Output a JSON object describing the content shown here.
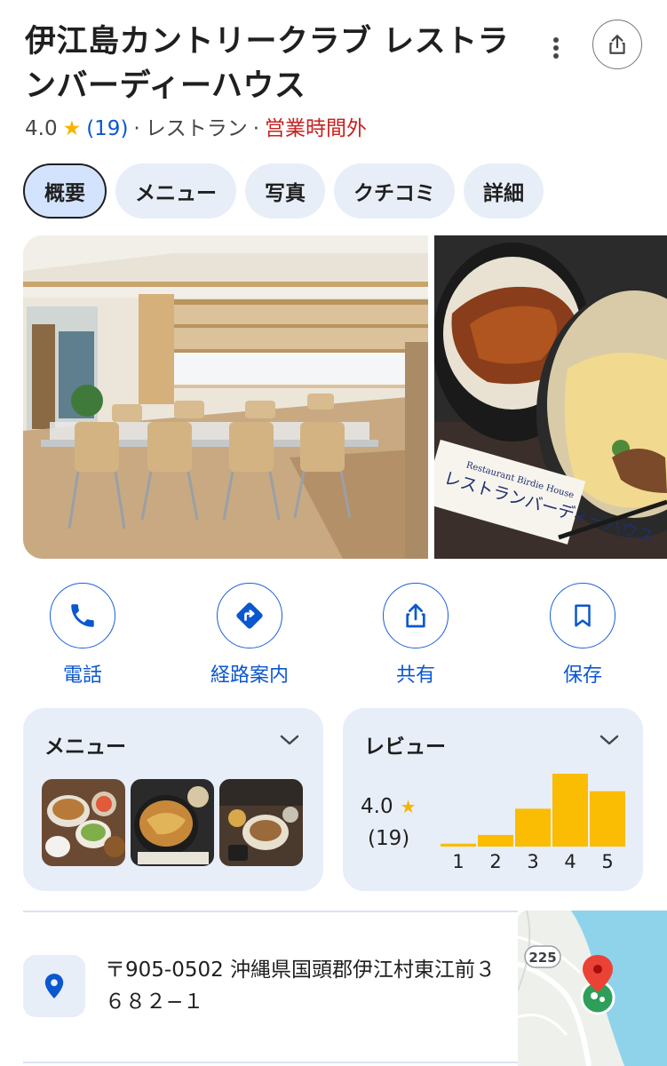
{
  "place": {
    "title": "伊江島カントリークラブ レストランバーディーハウス",
    "rating": "4.0",
    "star": "★",
    "review_count": "(19)",
    "separator": "·",
    "category": "レストラン",
    "status": "営業時間外"
  },
  "header": {
    "more_icon": "more-vert-icon",
    "share_icon": "share-icon"
  },
  "tabs": [
    {
      "label": "概要",
      "active": true
    },
    {
      "label": "メニュー",
      "active": false
    },
    {
      "label": "写真",
      "active": false
    },
    {
      "label": "クチコミ",
      "active": false
    },
    {
      "label": "詳細",
      "active": false
    }
  ],
  "photos": {
    "sign_text": "レストランバーディーハウス",
    "sign_subtext": "Restaurant Birdie House"
  },
  "actions": [
    {
      "label": "電話",
      "icon": "phone-icon"
    },
    {
      "label": "経路案内",
      "icon": "directions-icon"
    },
    {
      "label": "共有",
      "icon": "share-icon"
    },
    {
      "label": "保存",
      "icon": "bookmark-icon"
    }
  ],
  "menu_card": {
    "title": "メニュー",
    "thumbnails": [
      "set-meal-photo",
      "katsudon-photo",
      "dining-table-photo"
    ]
  },
  "review_card": {
    "title": "レビュー",
    "rating": "4.0",
    "star": "★",
    "count": "(19)"
  },
  "chart_data": {
    "type": "bar",
    "categories": [
      "1",
      "2",
      "3",
      "4",
      "5"
    ],
    "values": [
      0.04,
      0.16,
      0.52,
      1.0,
      0.76
    ],
    "bar_color": "#fbbc04"
  },
  "address": {
    "text": "〒905-0502 沖縄県国頭郡伊江村東江前３６８２−１",
    "icon": "location-pin-icon"
  },
  "map": {
    "route_label": "225"
  },
  "colors": {
    "accent": "#0b57d0",
    "star": "#f6b400",
    "closed": "#c5221f",
    "chip_bg": "#e8eef8"
  }
}
